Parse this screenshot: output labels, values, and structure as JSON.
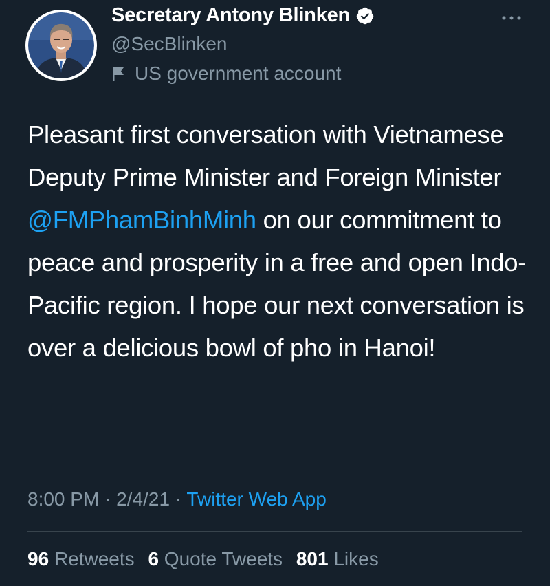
{
  "header": {
    "display_name": "Secretary Antony Blinken",
    "handle": "@SecBlinken",
    "label": "US government account",
    "verified": true,
    "verified_icon": "verified-badge-icon",
    "label_icon": "flag-icon",
    "more_icon": "more-options-icon"
  },
  "tweet": {
    "text_before_mention": "Pleasant first conversation with Vietnamese Deputy Prime Minister and Foreign Minister ",
    "mention": "@FMPhamBinhMinh",
    "text_after_mention": " on our commitment to peace and prosperity in a free and open Indo-Pacific region. I hope our next conversation is over a delicious bowl of pho in Hanoi!"
  },
  "meta": {
    "time": "8:00 PM",
    "separator": " · ",
    "date": "2/4/21",
    "source": "Twitter Web App"
  },
  "stats": {
    "retweets_count": "96",
    "retweets_label": "Retweets",
    "quotes_count": "6",
    "quotes_label": "Quote Tweets",
    "likes_count": "801",
    "likes_label": "Likes"
  },
  "colors": {
    "background": "#15202b",
    "text": "#ffffff",
    "secondary": "#8899a6",
    "accent": "#1da1f2",
    "divider": "#38444d"
  }
}
